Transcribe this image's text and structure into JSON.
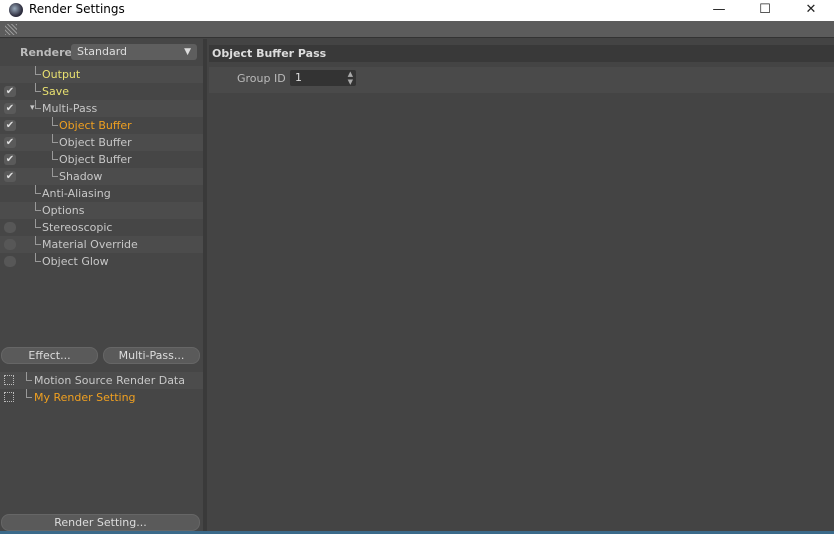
{
  "window": {
    "title": "Render Settings",
    "minimize": "—",
    "maximize": "☐",
    "close": "✕"
  },
  "renderer": {
    "label": "Renderer",
    "value": "Standard"
  },
  "tree": [
    {
      "label": "Output",
      "check": "none",
      "color": "yellow",
      "indent": 0
    },
    {
      "label": "Save",
      "check": "checked",
      "color": "yellow",
      "indent": 0
    },
    {
      "label": "Multi-Pass",
      "check": "checked",
      "color": "normal",
      "indent": 0,
      "expanded": true
    },
    {
      "label": "Object Buffer",
      "check": "checked",
      "color": "orange",
      "indent": 1
    },
    {
      "label": "Object Buffer",
      "check": "checked",
      "color": "normal",
      "indent": 1
    },
    {
      "label": "Object Buffer",
      "check": "checked",
      "color": "normal",
      "indent": 1
    },
    {
      "label": "Shadow",
      "check": "checked",
      "color": "normal",
      "indent": 1
    },
    {
      "label": "Anti-Aliasing",
      "check": "none",
      "color": "normal",
      "indent": 0
    },
    {
      "label": "Options",
      "check": "none",
      "color": "normal",
      "indent": 0
    },
    {
      "label": "Stereoscopic",
      "check": "unchecked",
      "color": "normal",
      "indent": 0
    },
    {
      "label": "Material Override",
      "check": "unchecked",
      "color": "normal",
      "indent": 0
    },
    {
      "label": "Object Glow",
      "check": "unchecked",
      "color": "normal",
      "indent": 0
    }
  ],
  "buttons": {
    "effect": "Effect...",
    "multipass": "Multi-Pass...",
    "render_setting": "Render Setting..."
  },
  "settings_list": [
    {
      "label": "Motion Source Render Data",
      "color": "normal"
    },
    {
      "label": "My Render Setting",
      "color": "orange"
    }
  ],
  "panel": {
    "title": "Object Buffer Pass",
    "group_id_label": "Group ID",
    "group_id_value": "1"
  }
}
